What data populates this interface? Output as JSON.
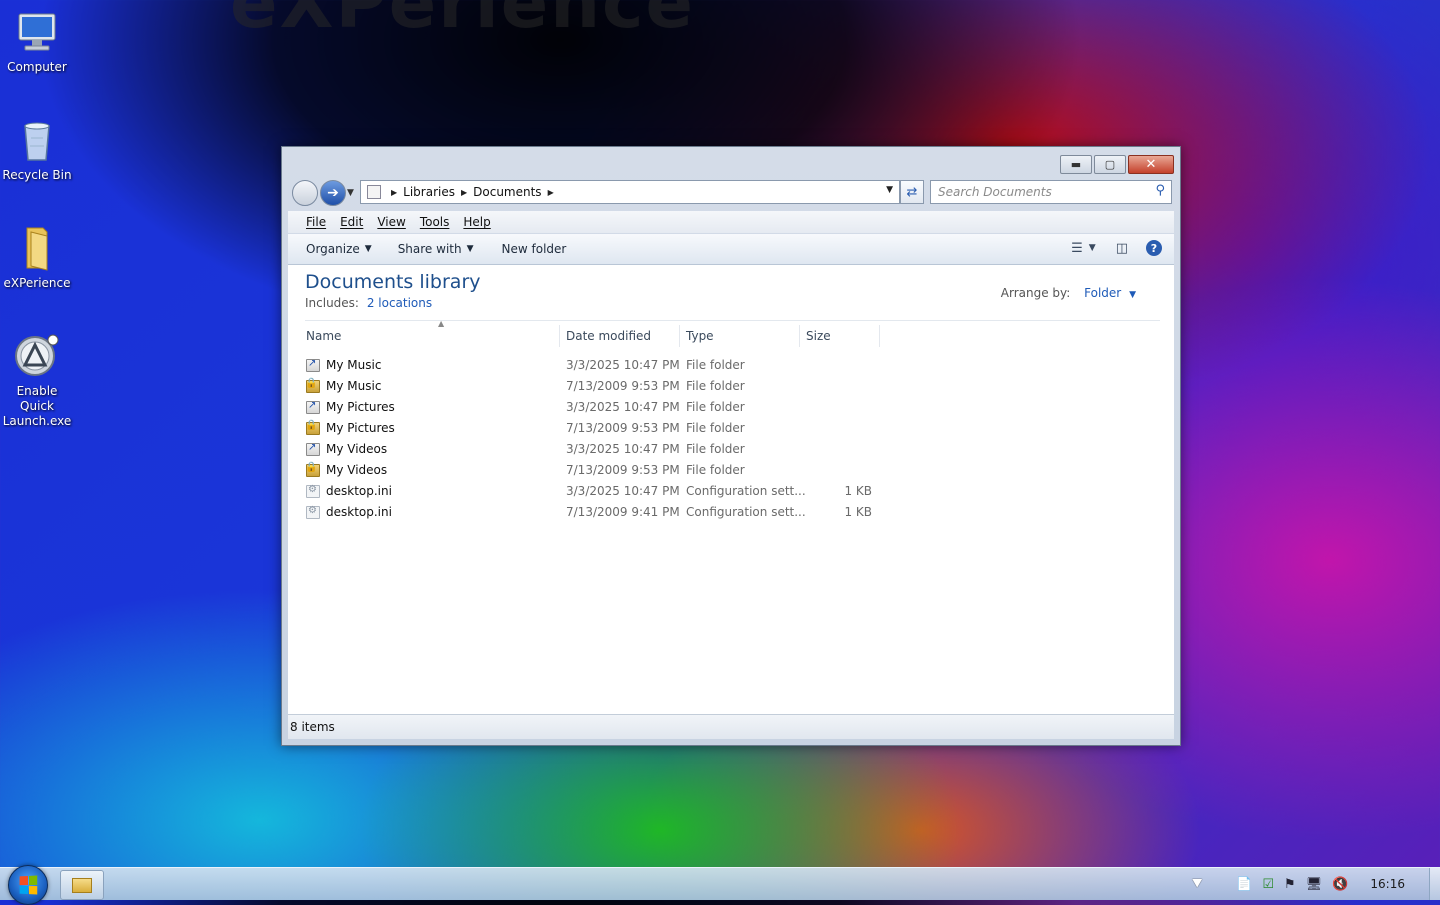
{
  "desktop": {
    "background_colors": [
      "#1a2fd6",
      "#000000",
      "#be0a0a",
      "#c814aa",
      "#1ebe1e",
      "#14bedc"
    ],
    "icons": [
      {
        "label": "Computer",
        "icon": "computer-icon"
      },
      {
        "label": "Recycle Bin",
        "icon": "recycle-bin-icon"
      },
      {
        "label": "eXPerience",
        "icon": "folder-icon"
      },
      {
        "label": "Enable Quick Launch.exe",
        "icon": "app-icon"
      }
    ]
  },
  "window": {
    "controls": {
      "minimize": "minimize-icon",
      "maximize": "maximize-icon",
      "close": "close-icon"
    },
    "address": {
      "crumbs": [
        "Libraries",
        "Documents"
      ]
    },
    "search": {
      "placeholder": "Search Documents"
    },
    "menu": [
      "File",
      "Edit",
      "View",
      "Tools",
      "Help"
    ],
    "commands": {
      "organize": "Organize",
      "share_with": "Share with",
      "new_folder": "New folder"
    },
    "library": {
      "title": "Documents library",
      "includes_label": "Includes:",
      "includes_link": "2 locations",
      "arrange_label": "Arrange by:",
      "arrange_value": "Folder"
    },
    "columns": {
      "name": "Name",
      "date": "Date modified",
      "type": "Type",
      "size": "Size"
    },
    "files": [
      {
        "name": "My Music",
        "date": "3/3/2025 10:47 PM",
        "type": "File folder",
        "size": "",
        "icon": "shortcut"
      },
      {
        "name": "My Music",
        "date": "7/13/2009 9:53 PM",
        "type": "File folder",
        "size": "",
        "icon": "locked"
      },
      {
        "name": "My Pictures",
        "date": "3/3/2025 10:47 PM",
        "type": "File folder",
        "size": "",
        "icon": "shortcut"
      },
      {
        "name": "My Pictures",
        "date": "7/13/2009 9:53 PM",
        "type": "File folder",
        "size": "",
        "icon": "locked"
      },
      {
        "name": "My Videos",
        "date": "3/3/2025 10:47 PM",
        "type": "File folder",
        "size": "",
        "icon": "shortcut"
      },
      {
        "name": "My Videos",
        "date": "7/13/2009 9:53 PM",
        "type": "File folder",
        "size": "",
        "icon": "locked"
      },
      {
        "name": "desktop.ini",
        "date": "3/3/2025 10:47 PM",
        "type": "Configuration sett...",
        "size": "1 KB",
        "icon": "ini"
      },
      {
        "name": "desktop.ini",
        "date": "7/13/2009 9:41 PM",
        "type": "Configuration sett...",
        "size": "1 KB",
        "icon": "ini"
      }
    ],
    "status": "8 items"
  },
  "taskbar": {
    "clock": "16:16",
    "tray_icons": [
      "action-center-icon",
      "security-icon",
      "flag-icon",
      "network-icon",
      "volume-muted-icon"
    ]
  }
}
